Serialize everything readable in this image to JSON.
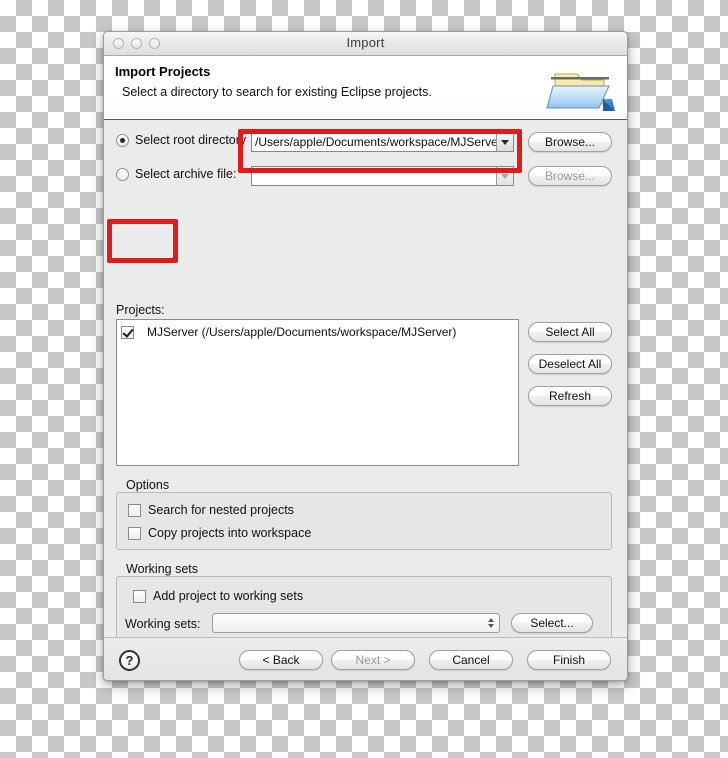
{
  "window": {
    "title": "Import",
    "traffic_lights": [
      "close",
      "minimize",
      "zoom"
    ]
  },
  "header": {
    "title": "Import Projects",
    "subtitle": "Select a directory to search for existing Eclipse projects.",
    "icon": "import-folder-icon"
  },
  "source": {
    "root_radio_label": "Select root directory",
    "root_radio_selected": true,
    "root_directory_value": "/Users/apple/Documents/workspace/MJServe",
    "root_browse_label": "Browse...",
    "archive_radio_label": "Select archive file:",
    "archive_radio_selected": false,
    "archive_value": "",
    "archive_browse_label": "Browse..."
  },
  "projects": {
    "label": "Projects:",
    "items": [
      {
        "checked": true,
        "label": "MJServer (/Users/apple/Documents/workspace/MJServer)"
      }
    ],
    "select_all_label": "Select All",
    "deselect_all_label": "Deselect All",
    "refresh_label": "Refresh"
  },
  "options": {
    "group_title": "Options",
    "items": [
      {
        "checked": false,
        "label": "Search for nested projects"
      },
      {
        "checked": false,
        "label": "Copy projects into workspace"
      }
    ]
  },
  "working_sets": {
    "group_title": "Working sets",
    "add_checkbox_label": "Add project to working sets",
    "add_checked": false,
    "field_label": "Working sets:",
    "field_value": "",
    "select_label": "Select..."
  },
  "footer": {
    "help_label": "?",
    "back_label": "< Back",
    "next_label": "Next >",
    "next_enabled": false,
    "cancel_label": "Cancel",
    "finish_label": "Finish"
  },
  "annotations": {
    "accent_color": "#e01b1b",
    "boxes": [
      "root-directory-highlight",
      "project-checkbox-highlight"
    ]
  }
}
